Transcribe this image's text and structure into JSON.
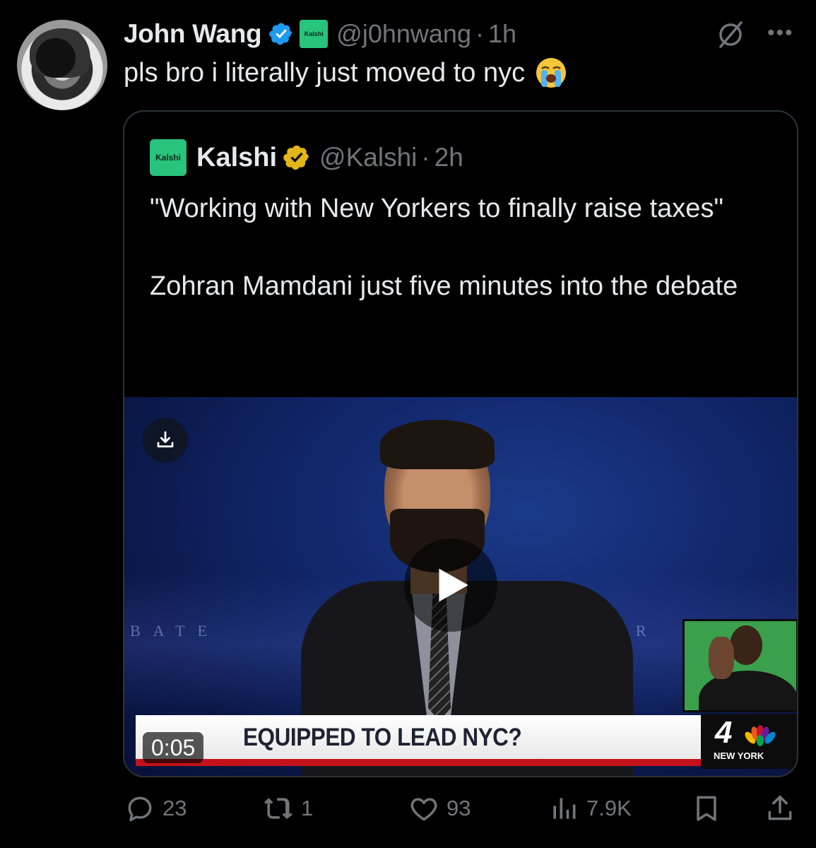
{
  "author": {
    "name": "John Wang",
    "affiliate_badge_text": "Kalshi",
    "handle": "@j0hnwang",
    "separator": "·",
    "time": "1h"
  },
  "tweet": {
    "text": "pls bro i literally just moved to nyc"
  },
  "quote": {
    "avatar_text": "Kalshi",
    "name": "Kalshi",
    "handle": "@Kalshi",
    "separator": "·",
    "time": "2h",
    "paragraph1": "\"Working with New Yorkers to finally raise taxes\"",
    "paragraph2": "Zohran Mamdani just five minutes into the debate",
    "video": {
      "duration": "0:05",
      "chyron": "EQUIPPED TO LEAD NYC?",
      "station_number": "4",
      "station_city": "NEW YORK",
      "backdrop_left": "BATE",
      "backdrop_right": "OR"
    }
  },
  "actions": {
    "replies": "23",
    "reposts": "1",
    "likes": "93",
    "views": "7.9K"
  },
  "colors": {
    "background": "#000000",
    "text": "#e7e9ea",
    "muted": "#71767b",
    "verified_blue": "#1d9bf0",
    "verified_gold": "#e2b719",
    "kalshi_green": "#28c37d",
    "border": "#2f3336"
  },
  "icons": [
    "verified-icon",
    "grok-icon",
    "more-icon",
    "crying-emoji",
    "download-icon",
    "play-icon",
    "reply-icon",
    "repost-icon",
    "like-icon",
    "views-icon",
    "bookmark-icon",
    "share-icon"
  ]
}
